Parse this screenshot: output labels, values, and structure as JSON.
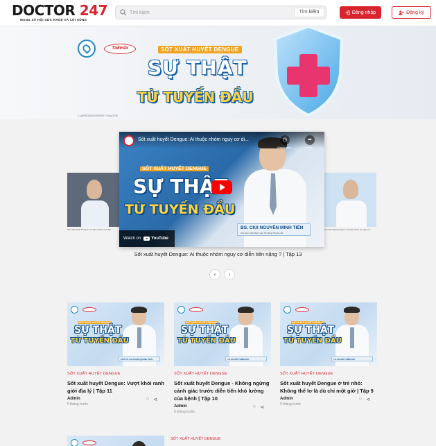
{
  "header": {
    "logo_word1": "DOCTOR",
    "logo_word2": "247",
    "logo_tagline": "MẠNG XÃ HỘI SỨC KHỎE VÀ LỐI SỐNG",
    "search_placeholder": "Tìm kiếm",
    "search_button": "Tìm kiếm",
    "login_label": "Đăng nhập",
    "signup_label": "Đăng ký",
    "colors": {
      "brand_red": "#d9232d",
      "brand_dark": "#1a1a1a"
    }
  },
  "hero": {
    "partner_logo": "Takeda",
    "kicker": "SỐT XUẤT HUYẾT DENGUE",
    "title_line1": "SỰ THẬT",
    "title_line2": "TỪ TUYẾN ĐẦU",
    "fine_print": "C-ANPROM/VN/DEN/0017 Aug 2026"
  },
  "video": {
    "title": "Sốt xuất huyết Dengue: Ai thuộc nhóm nguy cơ di...",
    "watch_later": "Watch later",
    "share": "Share",
    "kicker": "SỐT XUẤT HUYẾT DENGUE",
    "title_line1": "SỰ THẬT",
    "title_line2": "TỪ TUYẾN ĐẦU",
    "doctor_name": "BS. CKII NGUYỄN MINH TIẾN",
    "doctor_role": "Phó Giám đốc Bệnh viện Nhi đồng Thành phố",
    "watch_on": "Watch on",
    "youtube": "YouTube",
    "caption": "Sốt xuất huyết Dengue: Ai thuộc nhóm nguy cơ diễn tiến nặng ? | Tập 13",
    "side_left_caption": "Sốt xuất huyết Dengue: Từ biến chứng của đến ...",
    "side_right_caption": "Sốt xuất huyết Dengue: Ai thuộc nhóm có nguy cơ ...",
    "prev_label": "‹",
    "next_label": "›"
  },
  "cards": [
    {
      "thumb_kicker": "SỐT XUẤT HUYẾT DENGUE",
      "thumb_line1": "SỰ THẬT",
      "thumb_line2": "TỪ TUYẾN ĐẦU",
      "thumb_tag": "PGS.TS. BS PHẠM QUANG THÁI",
      "category": "SỐT XUẤT HUYẾT DENGUE",
      "title": "Sốt xuất huyết Dengue: Vượt khỏi ranh giới địa lý | Tập 11",
      "author": "Admin",
      "time": "5 tháng trước"
    },
    {
      "thumb_kicker": "SỐT XUẤT HUYẾT DENGUE",
      "thumb_line1": "SỰ THẬT",
      "thumb_line2": "TỪ TUYẾN ĐẦU",
      "thumb_tag": "TS. BS ĐỖ THIỆN HẢI",
      "category": "SỐT XUẤT HUYẾT DENGUE",
      "title": "Sốt xuất huyết Dengue - Không ngừng cảnh giác trước diễn tiến khó lường của bệnh | Tập 10",
      "author": "Admin",
      "time": "6 tháng trước"
    },
    {
      "thumb_kicker": "SỐT XUẤT HUYẾT DENGUE",
      "thumb_line1": "SỰ THẬT",
      "thumb_line2": "TỪ TUYẾN ĐẦU",
      "thumb_tag": "TS. BS ĐỖ THIỆN HẢI",
      "category": "SỐT XUẤT HUYẾT DENGUE",
      "title": "Sốt xuất huyết Dengue ở trẻ nhỏ: Không thể lơ là dù chỉ một giờ | Tập 9",
      "author": "Admin",
      "time": "6 tháng trước"
    }
  ],
  "bottom": {
    "category": "SỐT XUẤT HUYẾT DENGUE"
  },
  "icons": [
    "search-icon",
    "login-icon",
    "user-plus-icon",
    "clock-icon",
    "share-icon",
    "comment-icon",
    "play-icon"
  ]
}
